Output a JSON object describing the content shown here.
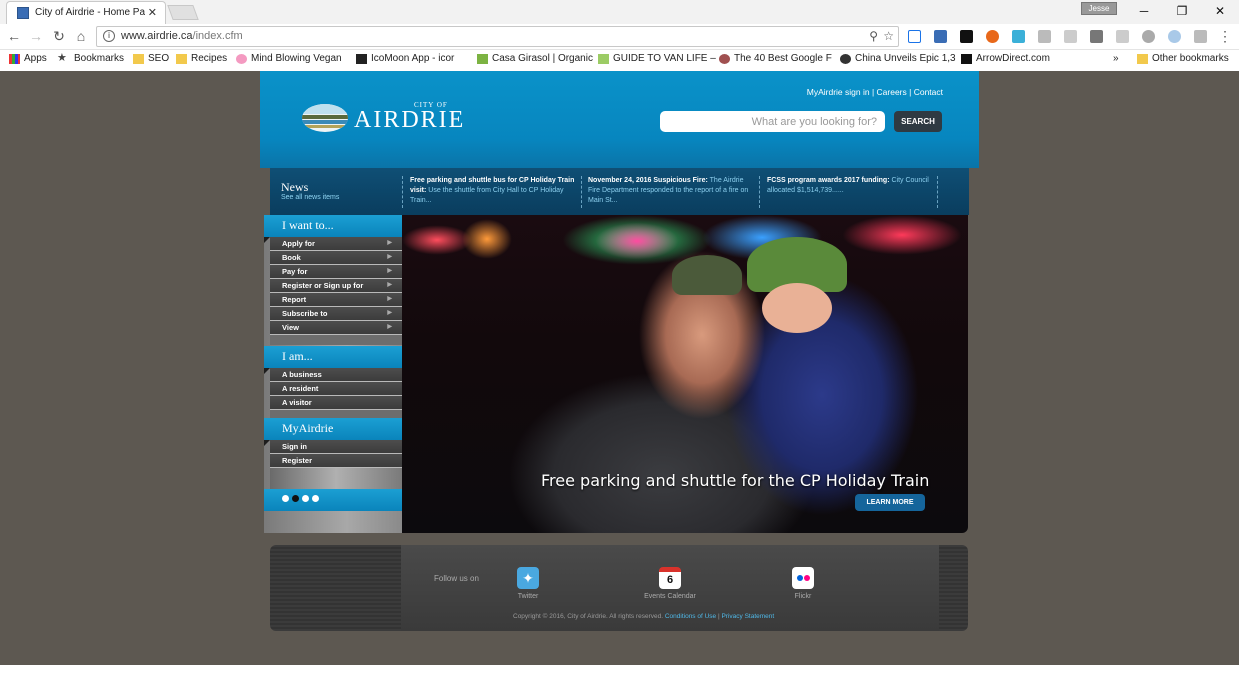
{
  "browser": {
    "tab_title": "City of Airdrie - Home Pa",
    "url_host": "www.airdrie.ca",
    "url_path": "/index.cfm",
    "profile_name": "Jesse",
    "bookmarks": [
      "Apps",
      "Bookmarks",
      "SEO",
      "Recipes",
      "Mind Blowing Vegan",
      "IcoMoon App - icor",
      "Casa Girasol | Organic",
      "GUIDE TO VAN LIFE –",
      "The 40 Best Google F",
      "China Unveils Epic 1,3",
      "ArrowDirect.com"
    ],
    "bookmarks_overflow": "»",
    "other_bookmarks": "Other bookmarks"
  },
  "header": {
    "links": [
      "MyAirdrie sign in",
      "Careers",
      "Contact"
    ],
    "logo_city_of": "CITY OF",
    "logo_name": "AIRDRIE",
    "search_placeholder": "What are you looking for?",
    "search_button": "SEARCH"
  },
  "news": {
    "label": "News",
    "see_all": "See all news items",
    "items": [
      {
        "title": "Free parking and shuttle bus for CP Holiday Train visit:",
        "text": "Use the shuttle from City Hall to CP Holiday Train..."
      },
      {
        "title": "November 24, 2016 Suspicious Fire:",
        "text": "The Airdrie Fire Department responded to the report of a fire on Main St..."
      },
      {
        "title": "FCSS program awards 2017 funding:",
        "text": "City Council allocated $1,514,739......"
      }
    ]
  },
  "sidebar": {
    "i_want_to": {
      "heading": "I want to...",
      "items": [
        "Apply for",
        "Book",
        "Pay for",
        "Register or Sign up for",
        "Report",
        "Subscribe to",
        "View"
      ]
    },
    "i_am": {
      "heading": "I am...",
      "items": [
        "A business",
        "A resident",
        "A visitor"
      ]
    },
    "myairdrie": {
      "heading": "MyAirdrie",
      "items": [
        "Sign in",
        "Register"
      ]
    },
    "slider_dots": {
      "total": 4,
      "active": 2
    }
  },
  "hero": {
    "caption": "Free parking and shuttle for the CP Holiday Train",
    "button": "LEARN MORE"
  },
  "footer": {
    "follow_label": "Follow us on",
    "social": [
      {
        "label": "Twitter",
        "icon": "twitter-icon",
        "color": "#4aa8e0"
      },
      {
        "label": "Events Calendar",
        "icon": "calendar-icon",
        "color": "#ffffff"
      },
      {
        "label": "Flickr",
        "icon": "flickr-icon",
        "color": "#ffffff"
      }
    ],
    "calendar_day": "6",
    "copyright": "Copyright © 2016, City of Airdrie. All rights reserved.",
    "links": [
      "Conditions of Use",
      "Privacy Statement"
    ]
  },
  "colors": {
    "brand_blue": "#0a92c9",
    "news_bar": "#0f4f75",
    "page_bg": "#5d5851",
    "button_blue": "#15659b"
  }
}
